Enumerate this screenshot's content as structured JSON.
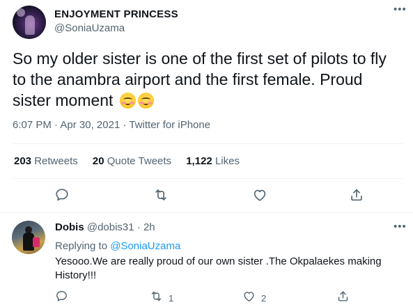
{
  "main_tweet": {
    "display_name": "ENJOYMENT PRINCESS",
    "handle": "@SoniaUzama",
    "text_before_emoji": "So my older sister is one of the first set of pilots to fly to the anambra airport and the first female. Proud sister moment ",
    "emoji_count": 2,
    "emoji_name": "smiling-face-with-blush",
    "time": "6:07 PM",
    "date": "Apr 30, 2021",
    "source": "Twitter for iPhone",
    "separator": " · ",
    "stats": {
      "retweets_count": "203",
      "retweets_label": "Retweets",
      "quotes_count": "20",
      "quotes_label": "Quote Tweets",
      "likes_count": "1,122",
      "likes_label": "Likes"
    }
  },
  "reply": {
    "display_name": "Dobis",
    "handle": "@dobis31",
    "time_ago": "2h",
    "replying_label": "Replying to ",
    "replying_to": "@SoniaUzama",
    "text": "Yesooo.We are really proud of our own sister .The Okpalaekes making History!!!",
    "retweet_count": "1",
    "like_count": "2"
  },
  "more_label": "•••",
  "colors": {
    "text": "#0f1419",
    "secondary": "#536471",
    "link": "#1d9bf0",
    "divider": "#eff3f4"
  }
}
